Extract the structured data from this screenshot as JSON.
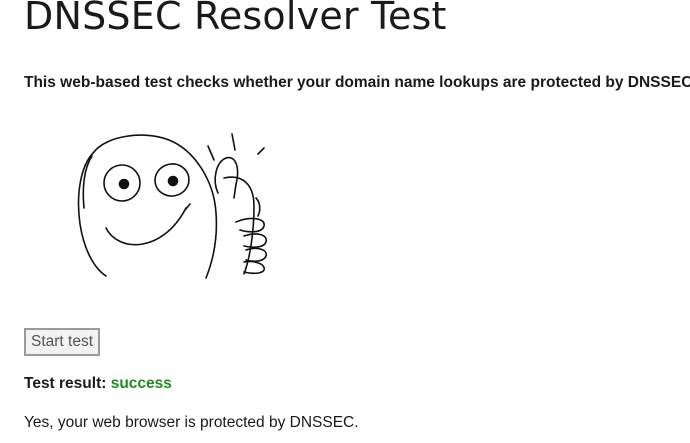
{
  "page": {
    "title": "DNSSEC Resolver Test",
    "intro": "This web-based test checks whether your domain name lookups are protected by DNSSEC."
  },
  "illustration": {
    "icon": "thumbs-up-face-icon"
  },
  "test": {
    "start_label": "Start test",
    "result_label": "Test result:",
    "result_status": "success",
    "result_message": "Yes, your web browser is protected by DNSSEC."
  },
  "colors": {
    "success": "#1e8c1e",
    "text": "#1a1a1a",
    "button_border": "#9a9a9a",
    "button_bg": "#f2f2f2"
  }
}
